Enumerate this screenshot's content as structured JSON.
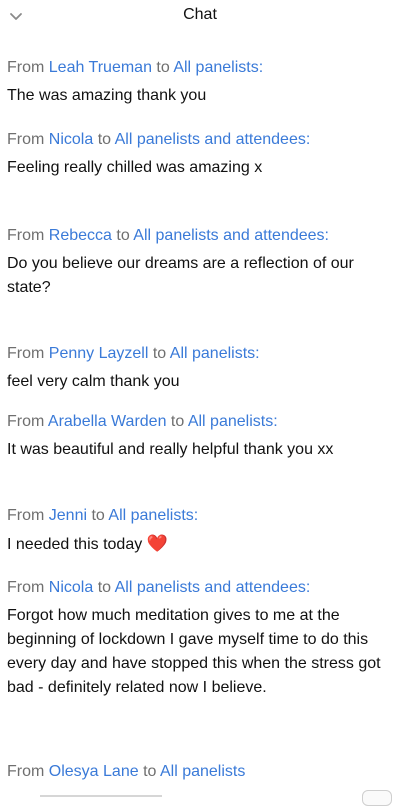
{
  "header": {
    "title": "Chat",
    "collapse_icon": "chevron-down-icon"
  },
  "messages": [
    {
      "from_label": "From",
      "sender": "Leah Trueman",
      "to_label": "to",
      "recipient": "All panelists",
      "suffix": ":",
      "text": "The was amazing thank you"
    },
    {
      "from_label": "From",
      "sender": "Nicola",
      "to_label": "to",
      "recipient": "All panelists and attendees",
      "suffix": ":",
      "text": "Feeling really chilled was amazing x"
    },
    {
      "from_label": "From",
      "sender": "Rebecca",
      "to_label": "to",
      "recipient": "All panelists and attendees",
      "suffix": ":",
      "text": "Do you believe our dreams are a reflection of our state?"
    },
    {
      "from_label": "From",
      "sender": "Penny Layzell",
      "to_label": "to",
      "recipient": "All panelists",
      "suffix": ":",
      "text": "feel very calm thank you"
    },
    {
      "from_label": "From",
      "sender": "Arabella Warden",
      "to_label": "to",
      "recipient": "All panelists",
      "suffix": ":",
      "text": "It was beautiful and really helpful thank you xx"
    },
    {
      "from_label": "From",
      "sender": "Jenni",
      "to_label": "to",
      "recipient": "All panelists",
      "suffix": ":",
      "text": "I needed this today",
      "emoji": "❤️"
    },
    {
      "from_label": "From",
      "sender": "Nicola",
      "to_label": "to",
      "recipient": "All panelists and attendees",
      "suffix": ":",
      "text": "Forgot how much meditation gives to me at the beginning of lockdown I gave myself time to do this every day and have stopped this when the stress got bad - definitely related now I believe."
    },
    {
      "from_label": "From",
      "sender": "Olesya Lane",
      "to_label": "to",
      "recipient": "All panelists",
      "suffix": "",
      "text": ""
    }
  ],
  "colors": {
    "link": "#3a7ad8",
    "meta": "#6f6f6f",
    "text": "#111111",
    "heart": "#e0242b"
  }
}
